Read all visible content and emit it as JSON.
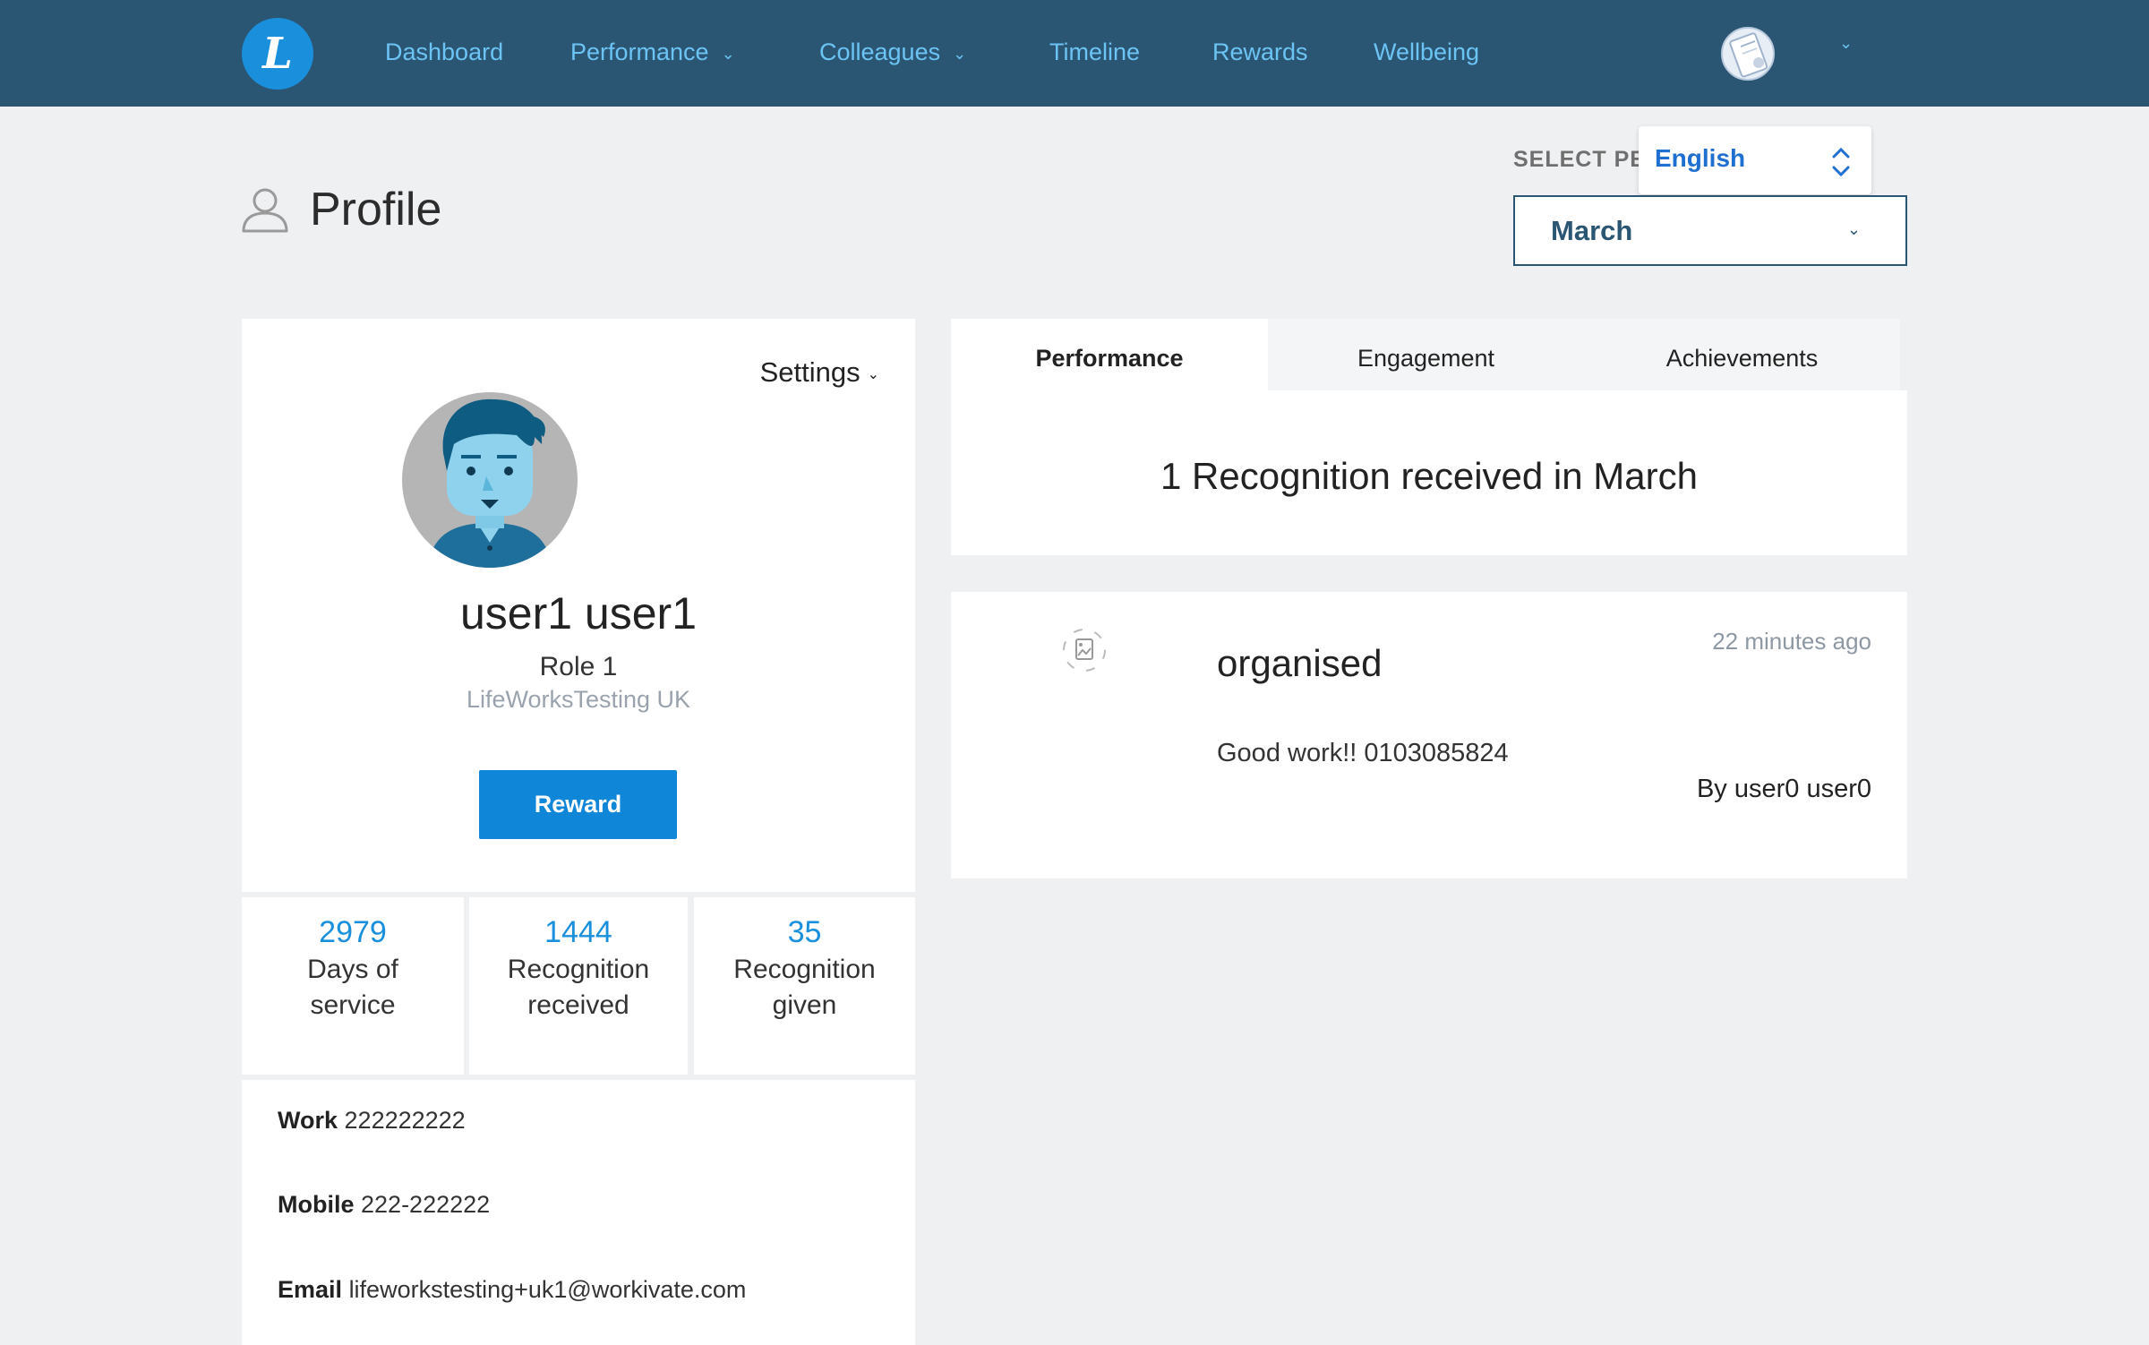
{
  "nav": {
    "logo_letter": "L",
    "items": [
      {
        "label": "Dashboard"
      },
      {
        "label": "Performance"
      },
      {
        "label": "Colleagues"
      },
      {
        "label": "Timeline"
      },
      {
        "label": "Rewards"
      },
      {
        "label": "Wellbeing"
      }
    ]
  },
  "header": {
    "title": "Profile",
    "period_label": "SELECT PERIOD",
    "language": "English",
    "period_value": "March"
  },
  "profile": {
    "settings_label": "Settings",
    "name": "user1 user1",
    "role": "Role 1",
    "company": "LifeWorksTesting UK",
    "reward_label": "Reward"
  },
  "stats": [
    {
      "value": "2979",
      "label_line1": "Days of",
      "label_line2": "service"
    },
    {
      "value": "1444",
      "label_line1": "Recognition",
      "label_line2": "received"
    },
    {
      "value": "35",
      "label_line1": "Recognition",
      "label_line2": "given"
    }
  ],
  "contact": {
    "work_label": "Work",
    "work_value": "222222222",
    "mobile_label": "Mobile",
    "mobile_value": "222-222222",
    "email_label": "Email",
    "email_value": "lifeworkstesting+uk1@workivate.com"
  },
  "tabs": [
    {
      "label": "Performance"
    },
    {
      "label": "Engagement"
    },
    {
      "label": "Achievements"
    }
  ],
  "summary": {
    "text": "1 Recognition received in March"
  },
  "recognition": {
    "title": "organised",
    "time": "22 minutes ago",
    "message": "Good work!! 0103085824",
    "by": "By user0 user0"
  },
  "colors": {
    "topbar": "#2a5673",
    "nav_link": "#6cc4f5",
    "accent": "#1a8fdb",
    "button": "#0f86d8",
    "background": "#eef0f2"
  },
  "icons": {
    "logo": "lifeworks-logo-icon",
    "profile": "user-outline-icon",
    "chevron": "chevron-down-icon",
    "language": "up-down-arrows-icon",
    "recognition": "broken-image-icon"
  }
}
